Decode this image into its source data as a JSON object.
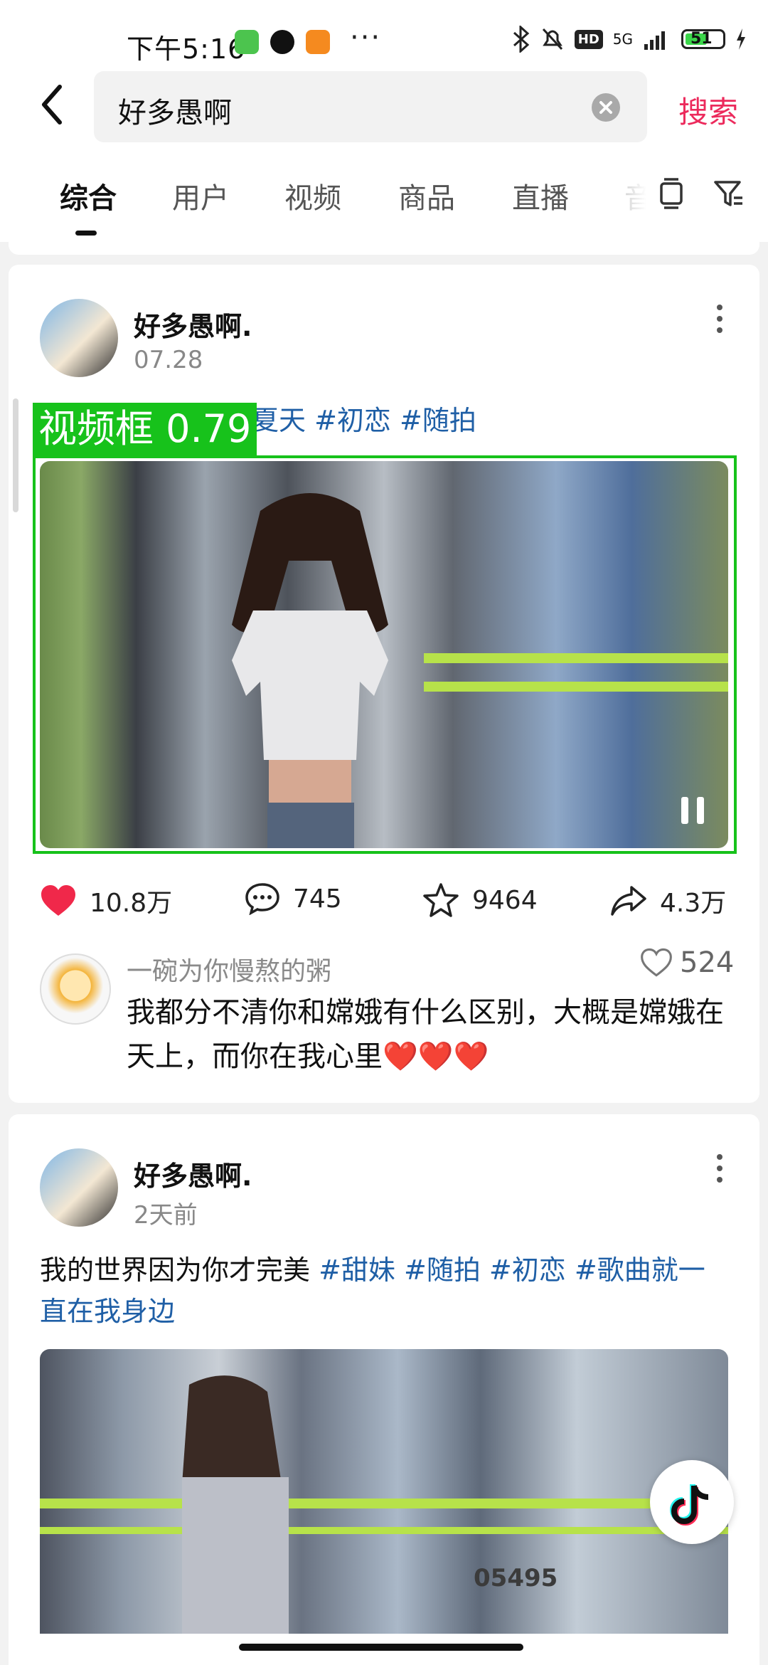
{
  "status_bar": {
    "time": "下午5:16",
    "signal": "5G",
    "hd": "HD",
    "battery": "51"
  },
  "search": {
    "query": "好多愚啊",
    "button": "搜索"
  },
  "tabs": [
    {
      "label": "综合",
      "active": true
    },
    {
      "label": "用户"
    },
    {
      "label": "视频"
    },
    {
      "label": "商品"
    },
    {
      "label": "直播"
    },
    {
      "label": "音"
    }
  ],
  "posts": [
    {
      "author": "好多愚啊.",
      "date": "07.28",
      "caption_tags": "夏天 #初恋 #随拍",
      "detection_label": "视频框 0.79",
      "likes": "10.8万",
      "comments": "745",
      "favorites": "9464",
      "shares": "4.3万",
      "top_comment": {
        "user": "一碗为你慢熬的粥",
        "likes": "524",
        "text": "我都分不清你和嫦娥有什么区别，大概是嫦娥在天上，而你在我心里❤️❤️❤️"
      }
    },
    {
      "author": "好多愚啊.",
      "date": "2天前",
      "caption_text": "我的世界因为你才完美 ",
      "caption_tags": "#甜妹 #随拍 #初恋 #歌曲就一直在我身边",
      "video_plate": "05495"
    }
  ],
  "colors": {
    "accent": "#ec2a5c",
    "tag": "#1f5fa6",
    "like": "#f0284a",
    "detection": "#17c21b"
  }
}
